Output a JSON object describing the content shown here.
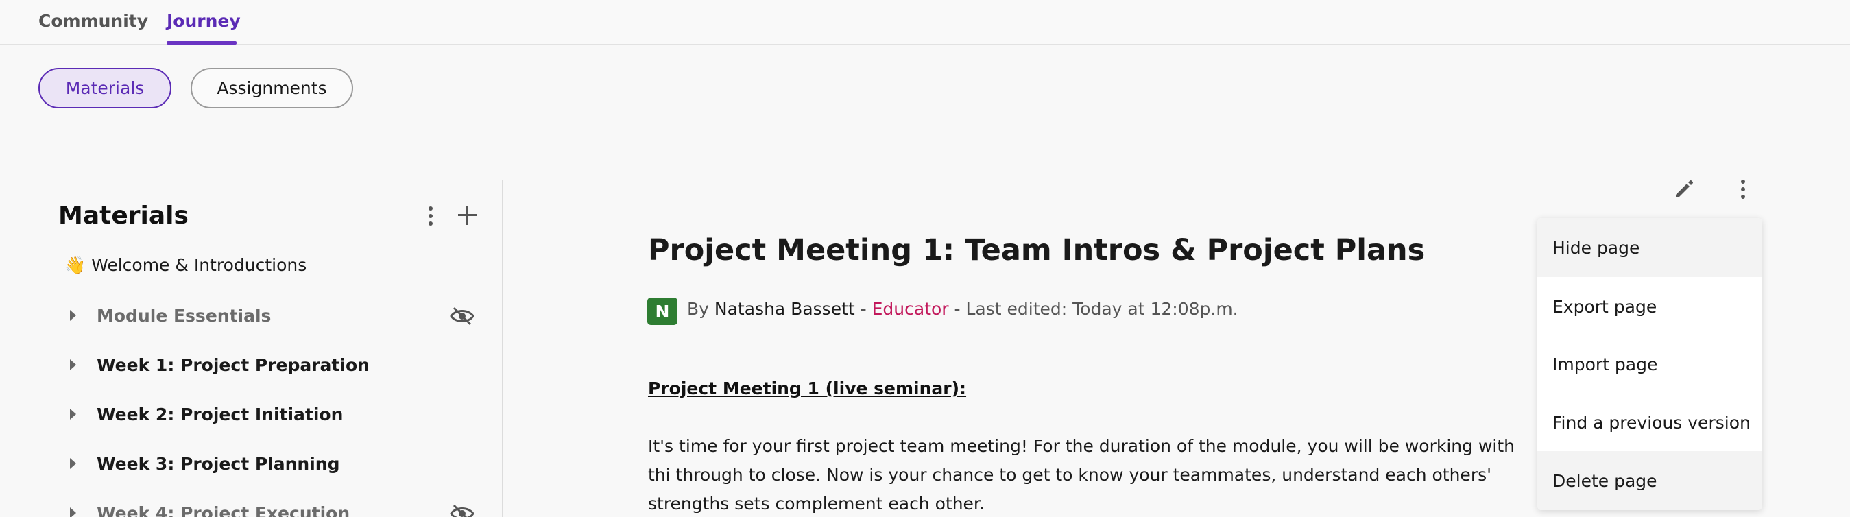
{
  "nav": {
    "tabs": [
      {
        "label": "Community",
        "active": false
      },
      {
        "label": "Journey",
        "active": true
      }
    ]
  },
  "subnav": {
    "pills": [
      {
        "label": "Materials",
        "active": true
      },
      {
        "label": "Assignments",
        "active": false
      }
    ]
  },
  "sidebar": {
    "title": "Materials",
    "welcome": "👋 Welcome & Introductions",
    "items": [
      {
        "label": "Module Essentials",
        "hidden": true
      },
      {
        "label": "Week 1: Project Preparation",
        "hidden": false
      },
      {
        "label": "Week 2: Project Initiation",
        "hidden": false
      },
      {
        "label": "Week 3: Project Planning",
        "hidden": false
      },
      {
        "label": "Week 4: Project Execution",
        "hidden": true
      }
    ]
  },
  "page": {
    "title": "Project Meeting 1: Team Intros & Project Plans",
    "avatar_initial": "N",
    "by_prefix": "By",
    "author": "Natasha Bassett",
    "sep1": " - ",
    "role": "Educator",
    "sep2": " - ",
    "last_edited": "Last edited: Today at 12:08p.m.",
    "section_heading": "Project Meeting 1 (live seminar):",
    "paragraph": "It's time for your first project team meeting! For the duration of the module, you will be working with thi through to close. Now is your chance to get to know your teammates, understand each others' strengths sets complement each other."
  },
  "menu": {
    "items": [
      "Hide page",
      "Export page",
      "Import page",
      "Find a previous version",
      "Delete page"
    ]
  },
  "colors": {
    "accent": "#5b2bb5",
    "role": "#c2185b",
    "avatar": "#2e7d32"
  }
}
